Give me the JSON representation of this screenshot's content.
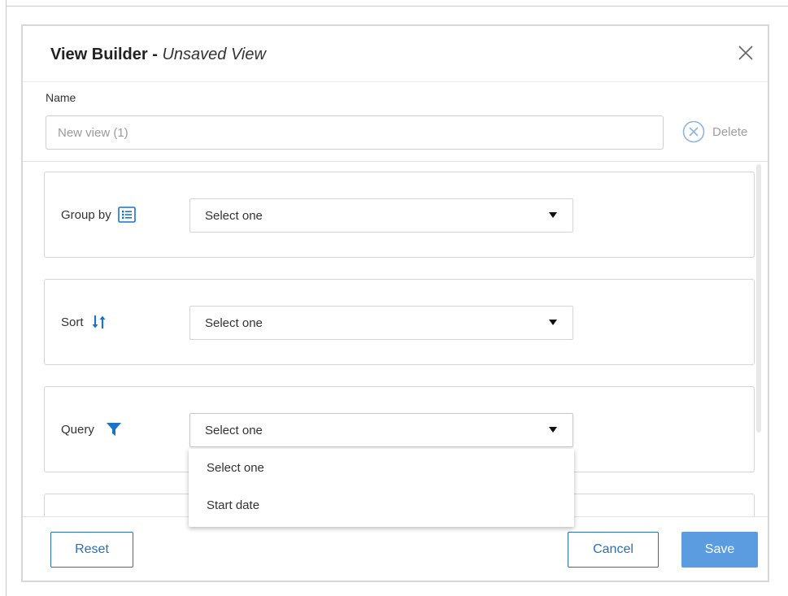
{
  "dialog": {
    "title_bold": "View Builder - ",
    "title_italic": "Unsaved View"
  },
  "name": {
    "label": "Name",
    "placeholder": "New view (1)",
    "value": ""
  },
  "delete_label": "Delete",
  "cards": {
    "group_by": {
      "label": "Group by",
      "icon": "list-icon",
      "selected": "Select one"
    },
    "sort": {
      "label": "Sort",
      "icon": "sort-arrows-icon",
      "selected": "Select one"
    },
    "query": {
      "label": "Query",
      "icon": "filter-icon",
      "selected": "Select one"
    }
  },
  "query_dropdown": {
    "options": [
      "Select one",
      "Start date"
    ]
  },
  "footer": {
    "reset_label": "Reset",
    "cancel_label": "Cancel",
    "save_label": "Save"
  },
  "colors": {
    "accent": "#1a73c8",
    "primary_button": "#5b9be0",
    "outline_button": "#2a6fb8"
  }
}
